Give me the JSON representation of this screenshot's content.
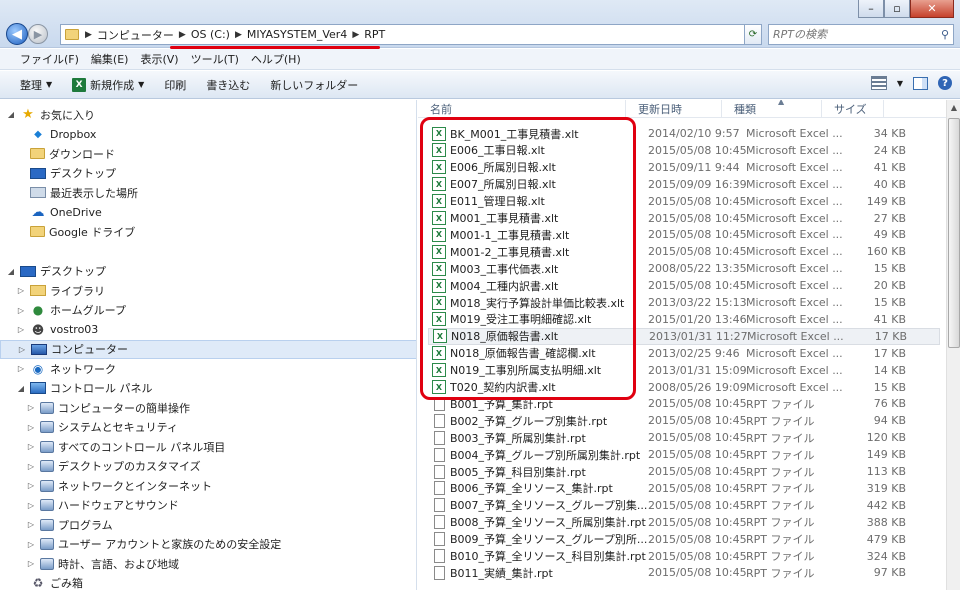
{
  "address": {
    "segments": [
      "コンピューター",
      "OS (C:)",
      "MIYASYSTEM_Ver4",
      "RPT"
    ],
    "search_placeholder": "RPTの検索"
  },
  "menu": [
    "ファイル(F)",
    "編集(E)",
    "表示(V)",
    "ツール(T)",
    "ヘルプ(H)"
  ],
  "toolbar": {
    "organize": "整理",
    "new": "新規作成",
    "print": "印刷",
    "burn": "書き込む",
    "new_folder": "新しいフォルダー"
  },
  "nav": [
    {
      "label": "お気に入り",
      "level": 0,
      "icon": "star-icon",
      "tw": "◢"
    },
    {
      "label": "Dropbox",
      "level": 1,
      "icon": "dropbox-icon"
    },
    {
      "label": "ダウンロード",
      "level": 1,
      "icon": "folder-icon"
    },
    {
      "label": "デスクトップ",
      "level": 1,
      "icon": "desktop-icon"
    },
    {
      "label": "最近表示した場所",
      "level": 1,
      "icon": "recent-places-icon"
    },
    {
      "label": "OneDrive",
      "level": 1,
      "icon": "onedrive-icon"
    },
    {
      "label": "Google ドライブ",
      "level": 1,
      "icon": "folder-icon"
    },
    {
      "label": "デスクトップ",
      "level": 0,
      "icon": "desktop-icon",
      "tw": "◢",
      "gap": true
    },
    {
      "label": "ライブラリ",
      "level": 1,
      "icon": "library-icon",
      "tw": "▷"
    },
    {
      "label": "ホームグループ",
      "level": 1,
      "icon": "homegroup-icon",
      "tw": "▷"
    },
    {
      "label": "vostro03",
      "level": 1,
      "icon": "user-icon",
      "tw": "▷"
    },
    {
      "label": "コンピューター",
      "level": 1,
      "icon": "computer-icon",
      "tw": "▷",
      "selected": true
    },
    {
      "label": "ネットワーク",
      "level": 1,
      "icon": "network-icon",
      "tw": "▷"
    },
    {
      "label": "コントロール パネル",
      "level": 1,
      "icon": "control-panel-icon",
      "tw": "◢"
    },
    {
      "label": "コンピューターの簡単操作",
      "level": 2,
      "icon": "ease-of-access-icon",
      "tw": "▷"
    },
    {
      "label": "システムとセキュリティ",
      "level": 2,
      "icon": "security-icon",
      "tw": "▷"
    },
    {
      "label": "すべてのコントロール パネル項目",
      "level": 2,
      "icon": "control-panel-items-icon",
      "tw": "▷"
    },
    {
      "label": "デスクトップのカスタマイズ",
      "level": 2,
      "icon": "customize-icon",
      "tw": "▷"
    },
    {
      "label": "ネットワークとインターネット",
      "level": 2,
      "icon": "network-internet-icon",
      "tw": "▷"
    },
    {
      "label": "ハードウェアとサウンド",
      "level": 2,
      "icon": "hardware-sound-icon",
      "tw": "▷"
    },
    {
      "label": "プログラム",
      "level": 2,
      "icon": "programs-icon",
      "tw": "▷"
    },
    {
      "label": "ユーザー アカウントと家族のための安全設定",
      "level": 2,
      "icon": "user-accounts-icon",
      "tw": "▷"
    },
    {
      "label": "時計、言語、および地域",
      "level": 2,
      "icon": "clock-language-icon",
      "tw": "▷"
    },
    {
      "label": "ごみ箱",
      "level": 1,
      "icon": "recycle-bin-icon"
    }
  ],
  "columns": {
    "name": "名前",
    "date": "更新日時",
    "type": "種類",
    "size": "サイズ"
  },
  "files": [
    {
      "name": "BK_M001_工事見積書.xlt",
      "date": "2014/02/10 9:57",
      "type": "Microsoft Excel ...",
      "size": "34 KB",
      "kind": "xl"
    },
    {
      "name": "E006_工事日報.xlt",
      "date": "2015/05/08 10:45",
      "type": "Microsoft Excel ...",
      "size": "24 KB",
      "kind": "xl"
    },
    {
      "name": "E006_所属別日報.xlt",
      "date": "2015/09/11 9:44",
      "type": "Microsoft Excel ...",
      "size": "41 KB",
      "kind": "xl"
    },
    {
      "name": "E007_所属別日報.xlt",
      "date": "2015/09/09 16:39",
      "type": "Microsoft Excel ...",
      "size": "40 KB",
      "kind": "xl"
    },
    {
      "name": "E011_管理日報.xlt",
      "date": "2015/05/08 10:45",
      "type": "Microsoft Excel ...",
      "size": "149 KB",
      "kind": "xl"
    },
    {
      "name": "M001_工事見積書.xlt",
      "date": "2015/05/08 10:45",
      "type": "Microsoft Excel ...",
      "size": "27 KB",
      "kind": "xl"
    },
    {
      "name": "M001-1_工事見積書.xlt",
      "date": "2015/05/08 10:45",
      "type": "Microsoft Excel ...",
      "size": "49 KB",
      "kind": "xl"
    },
    {
      "name": "M001-2_工事見積書.xlt",
      "date": "2015/05/08 10:45",
      "type": "Microsoft Excel ...",
      "size": "160 KB",
      "kind": "xl"
    },
    {
      "name": "M003_工事代価表.xlt",
      "date": "2008/05/22 13:35",
      "type": "Microsoft Excel ...",
      "size": "15 KB",
      "kind": "xl"
    },
    {
      "name": "M004_工種内訳書.xlt",
      "date": "2015/05/08 10:45",
      "type": "Microsoft Excel ...",
      "size": "20 KB",
      "kind": "xl"
    },
    {
      "name": "M018_実行予算設計単価比較表.xlt",
      "date": "2013/03/22 15:13",
      "type": "Microsoft Excel ...",
      "size": "15 KB",
      "kind": "xl"
    },
    {
      "name": "M019_受注工事明細確認.xlt",
      "date": "2015/01/20 13:46",
      "type": "Microsoft Excel ...",
      "size": "41 KB",
      "kind": "xl"
    },
    {
      "name": "N018_原価報告書.xlt",
      "date": "2013/01/31 11:27",
      "type": "Microsoft Excel ...",
      "size": "17 KB",
      "kind": "xl",
      "selected": true
    },
    {
      "name": "N018_原価報告書_確認欄.xlt",
      "date": "2013/02/25 9:46",
      "type": "Microsoft Excel ...",
      "size": "17 KB",
      "kind": "xl"
    },
    {
      "name": "N019_工事別所属支払明細.xlt",
      "date": "2013/01/31 15:09",
      "type": "Microsoft Excel ...",
      "size": "14 KB",
      "kind": "xl"
    },
    {
      "name": "T020_契約内訳書.xlt",
      "date": "2008/05/26 19:09",
      "type": "Microsoft Excel ...",
      "size": "15 KB",
      "kind": "xl"
    },
    {
      "name": "B001_予算_集計.rpt",
      "date": "2015/05/08 10:45",
      "type": "RPT ファイル",
      "size": "76 KB",
      "kind": "rpt"
    },
    {
      "name": "B002_予算_グループ別集計.rpt",
      "date": "2015/05/08 10:45",
      "type": "RPT ファイル",
      "size": "94 KB",
      "kind": "rpt"
    },
    {
      "name": "B003_予算_所属別集計.rpt",
      "date": "2015/05/08 10:45",
      "type": "RPT ファイル",
      "size": "120 KB",
      "kind": "rpt"
    },
    {
      "name": "B004_予算_グループ別所属別集計.rpt",
      "date": "2015/05/08 10:45",
      "type": "RPT ファイル",
      "size": "149 KB",
      "kind": "rpt"
    },
    {
      "name": "B005_予算_科目別集計.rpt",
      "date": "2015/05/08 10:45",
      "type": "RPT ファイル",
      "size": "113 KB",
      "kind": "rpt"
    },
    {
      "name": "B006_予算_全リソース_集計.rpt",
      "date": "2015/05/08 10:45",
      "type": "RPT ファイル",
      "size": "319 KB",
      "kind": "rpt"
    },
    {
      "name": "B007_予算_全リソース_グループ別集...",
      "date": "2015/05/08 10:45",
      "type": "RPT ファイル",
      "size": "442 KB",
      "kind": "rpt"
    },
    {
      "name": "B008_予算_全リソース_所属別集計.rpt",
      "date": "2015/05/08 10:45",
      "type": "RPT ファイル",
      "size": "388 KB",
      "kind": "rpt"
    },
    {
      "name": "B009_予算_全リソース_グループ別所...",
      "date": "2015/05/08 10:45",
      "type": "RPT ファイル",
      "size": "479 KB",
      "kind": "rpt"
    },
    {
      "name": "B010_予算_全リソース_科目別集計.rpt",
      "date": "2015/05/08 10:45",
      "type": "RPT ファイル",
      "size": "324 KB",
      "kind": "rpt"
    },
    {
      "name": "B011_実績_集計.rpt",
      "date": "2015/05/08 10:45",
      "type": "RPT ファイル",
      "size": "97 KB",
      "kind": "rpt"
    }
  ]
}
